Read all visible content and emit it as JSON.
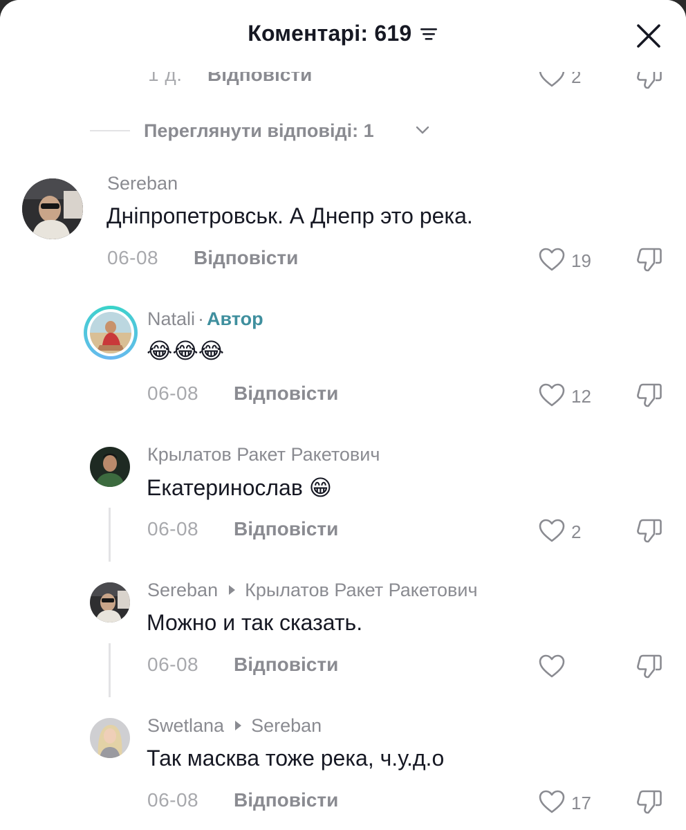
{
  "header": {
    "title": "Коментарі: 619"
  },
  "cut_row": {
    "time": "1 д.",
    "reply_label": "Відповісти",
    "likes": "2"
  },
  "view_replies": {
    "label": "Переглянути відповіді: 1"
  },
  "comments": [
    {
      "user": "Sereban",
      "text": "Дніпропетровськ. А Днепр это река.",
      "time": "06-08",
      "reply_label": "Відповісти",
      "likes": "19"
    },
    {
      "user": "Natali",
      "separator": "·",
      "badge": "Автор",
      "text": "😂😂😂",
      "time": "06-08",
      "reply_label": "Відповісти",
      "likes": "12"
    },
    {
      "user": "Крылатов Ракет Ракетович",
      "text": "Екатеринослав 😁",
      "time": "06-08",
      "reply_label": "Відповісти",
      "likes": "2"
    },
    {
      "user": "Sereban",
      "reply_to": "Крылатов Ракет Ракетович",
      "text": "Можно и так сказать.",
      "time": "06-08",
      "reply_label": "Відповісти",
      "likes": ""
    },
    {
      "user": "Swetlana",
      "reply_to": "Sereban",
      "text": "Так масква тоже река, ч.у.д.о",
      "time": "06-08",
      "reply_label": "Відповісти",
      "likes": "17"
    }
  ],
  "icons": {
    "sort": "sort-icon",
    "close": "close-icon",
    "like": "heart-outline-icon",
    "dislike": "thumbs-down-outline-icon",
    "chevron": "chevron-down-icon"
  },
  "colors": {
    "background": "#ffffff",
    "primary_text": "#161823",
    "secondary_text": "#8a8b91",
    "author_badge": "#3f8f9e"
  }
}
